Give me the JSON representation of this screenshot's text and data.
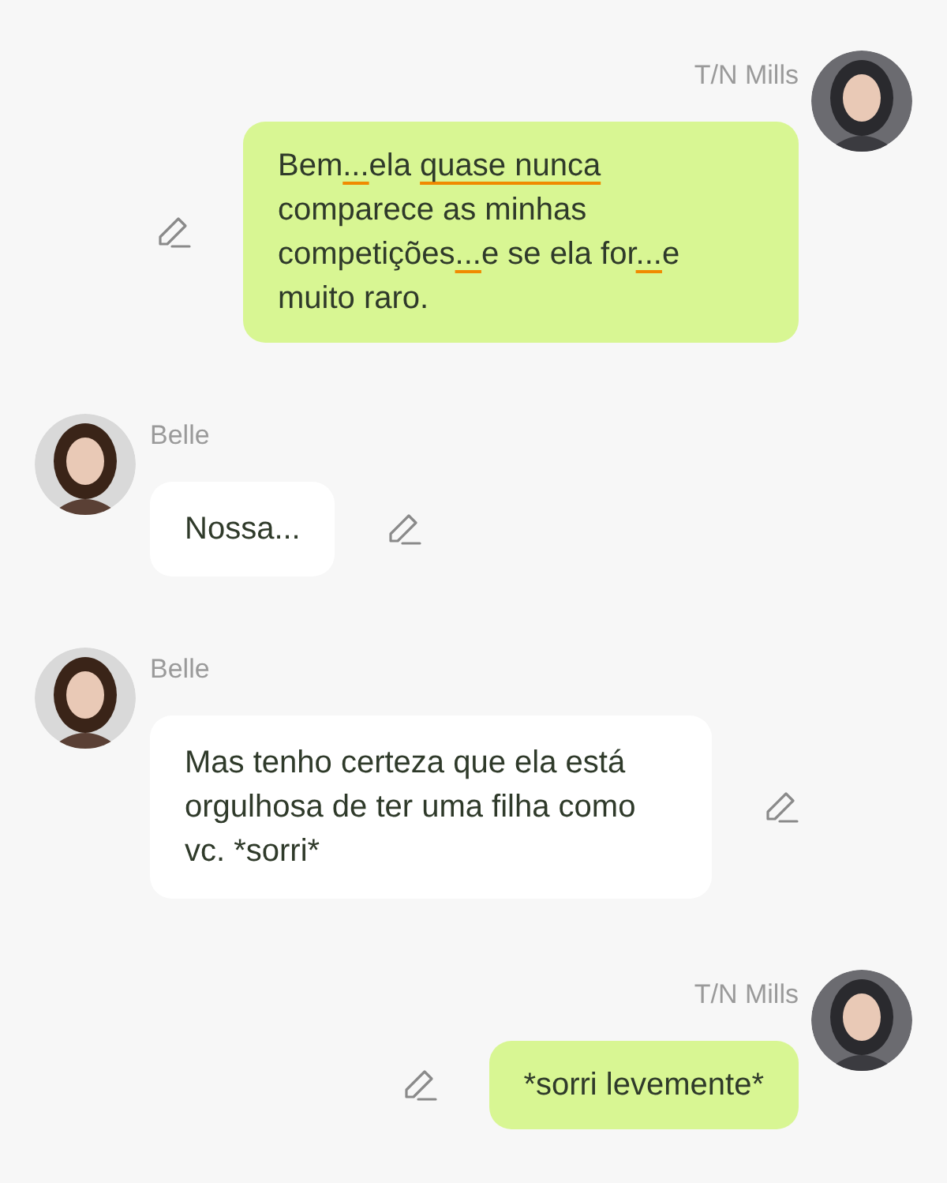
{
  "messages": [
    {
      "kind": "me",
      "author": "T/N Mills",
      "segments": [
        {
          "text": "Bem",
          "flagged": false
        },
        {
          "text": "...",
          "flagged": true
        },
        {
          "text": "ela ",
          "flagged": false
        },
        {
          "text": "quase nunca",
          "flagged": true
        },
        {
          "text": " comparece as minhas competições",
          "flagged": false
        },
        {
          "text": "...",
          "flagged": true
        },
        {
          "text": "e se ela for",
          "flagged": false
        },
        {
          "text": "...",
          "flagged": true
        },
        {
          "text": "e muito raro.",
          "flagged": false
        }
      ]
    },
    {
      "kind": "other",
      "author": "Belle",
      "segments": [
        {
          "text": "Nossa...",
          "flagged": false
        }
      ]
    },
    {
      "kind": "other",
      "author": "Belle",
      "segments": [
        {
          "text": "Mas tenho certeza que ela está orgulhosa de ter uma filha como vc. *sorri*",
          "flagged": false
        }
      ]
    },
    {
      "kind": "me",
      "author": "T/N Mills",
      "segments": [
        {
          "text": "*sorri levemente*",
          "flagged": false
        }
      ]
    }
  ]
}
